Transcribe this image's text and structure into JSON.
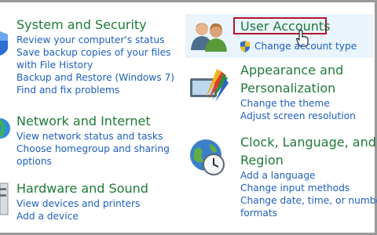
{
  "categories": {
    "system": {
      "title": "System and Security",
      "links": [
        "Review your computer's status",
        "Save backup copies of your files",
        "with File History",
        "Backup and Restore (Windows 7)",
        "Find and fix problems"
      ]
    },
    "network": {
      "title": "Network and Internet",
      "links": [
        "View network status and tasks",
        "Choose homegroup and sharing",
        "options"
      ]
    },
    "hardware": {
      "title": "Hardware and Sound",
      "links": [
        "View devices and printers",
        "Add a device"
      ]
    },
    "user_accounts": {
      "title": "User Accounts",
      "links": [
        "Change account type"
      ]
    },
    "appearance": {
      "title_line1": "Appearance and",
      "title_line2": "Personalization",
      "links": [
        "Change the theme",
        "Adjust screen resolution"
      ]
    },
    "clock": {
      "title_line1": "Clock, Language, and",
      "title_line2": "Region",
      "links": [
        "Add a language",
        "Change input methods",
        "Change date, time, or number",
        "formats"
      ]
    }
  },
  "colors": {
    "heading": "#1e7a3a",
    "link": "#1f5fbf",
    "highlight_border": "#b0182c"
  }
}
